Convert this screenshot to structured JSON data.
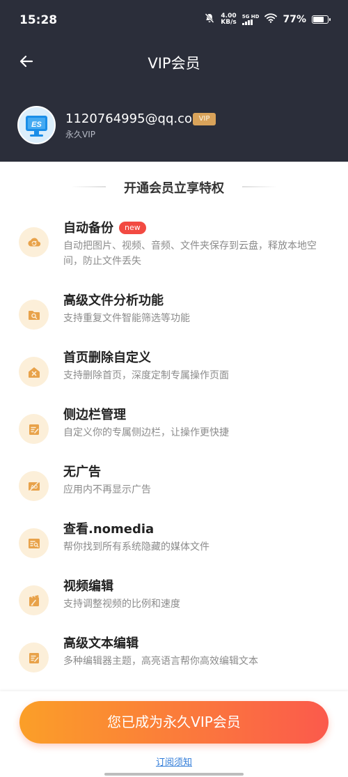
{
  "status_bar": {
    "time": "15:28",
    "net_speed": "4.00",
    "net_unit": "KB/s",
    "network_type": "5G HD",
    "battery_percent": "77%",
    "battery_level": 0.77
  },
  "header": {
    "title": "VIP会员",
    "back_icon": "arrow-left-icon"
  },
  "user": {
    "email": "1120764995@qq.com",
    "badge": "VIP",
    "membership": "永久VIP",
    "avatar_text": "ES"
  },
  "section": {
    "title": "开通会员立享特权"
  },
  "features": [
    {
      "name": "自动备份",
      "tag": "new",
      "desc": "自动把图片、视频、音频、文件夹保存到云盘，释放本地空间，防止文件丢失",
      "icon": "cloud-sync-icon"
    },
    {
      "name": "高级文件分析功能",
      "desc": "支持重复文件智能筛选等功能",
      "icon": "folder-search-icon"
    },
    {
      "name": "首页删除自定义",
      "desc": "支持删除首页，深度定制专属操作页面",
      "icon": "home-delete-icon"
    },
    {
      "name": "侧边栏管理",
      "desc": "自定义你的专属侧边栏，让操作更快捷",
      "icon": "edit-list-icon"
    },
    {
      "name": "无广告",
      "desc": "应用内不再显示广告",
      "icon": "no-ad-icon"
    },
    {
      "name": "查看.nomedia",
      "desc": "帮你找到所有系统隐藏的媒体文件",
      "icon": "media-search-icon"
    },
    {
      "name": "视频编辑",
      "desc": "支持调整视频的比例和速度",
      "icon": "video-edit-icon"
    },
    {
      "name": "高级文本编辑",
      "desc": "多种编辑器主题，高亮语言帮你高效编辑文本",
      "icon": "text-edit-icon"
    }
  ],
  "footer": {
    "cta_label": "您已成为永久VIP会员",
    "terms_link": "订阅须知"
  },
  "colors": {
    "header_bg": "#2b2e3a",
    "accent_start": "#fb9f28",
    "accent_end": "#fb5a4c",
    "icon_bg": "#fcefd9",
    "icon_fg": "#e8a24a"
  }
}
